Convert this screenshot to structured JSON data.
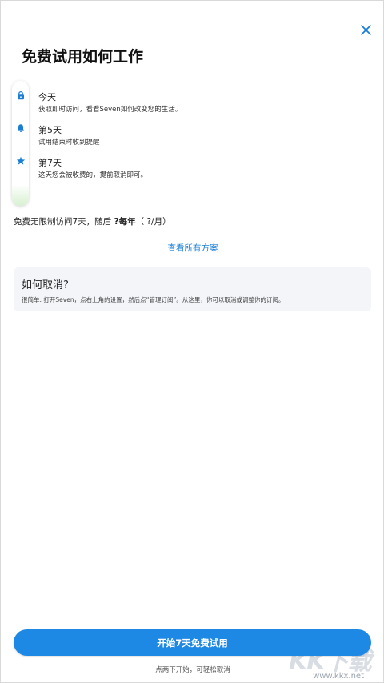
{
  "header": {
    "close_icon": "close-icon",
    "title": "免费试用如何工作"
  },
  "timeline": {
    "steps": [
      {
        "icon": "lock-icon",
        "title": "今天",
        "desc": "获取即时访问，看看Seven如何改变您的生活。"
      },
      {
        "icon": "bell-icon",
        "title": "第5天",
        "desc": "试用结束时收到提醒"
      },
      {
        "icon": "star-icon",
        "title": "第7天",
        "desc": "这天您会被收费的，提前取消即可。"
      }
    ],
    "accent_color": "#1a7fd4"
  },
  "pricing": {
    "prefix": "免费无限制访问7天，随后 ",
    "bold": "?每年",
    "suffix": "（ ?/月）"
  },
  "plans_link": "查看所有方案",
  "cancel_info": {
    "title": "如何取消?",
    "body": "很简单: 打开Seven，点右上角的设置，然后点“管理订阅”。从这里，你可以取消或调整你的订阅。"
  },
  "cta": {
    "label": "开始7天免费试用",
    "subtext": "点两下开始，可轻松取消",
    "color": "#1e88e5"
  },
  "watermark": {
    "letters": "KK下载",
    "url": "www.kkx.net"
  }
}
